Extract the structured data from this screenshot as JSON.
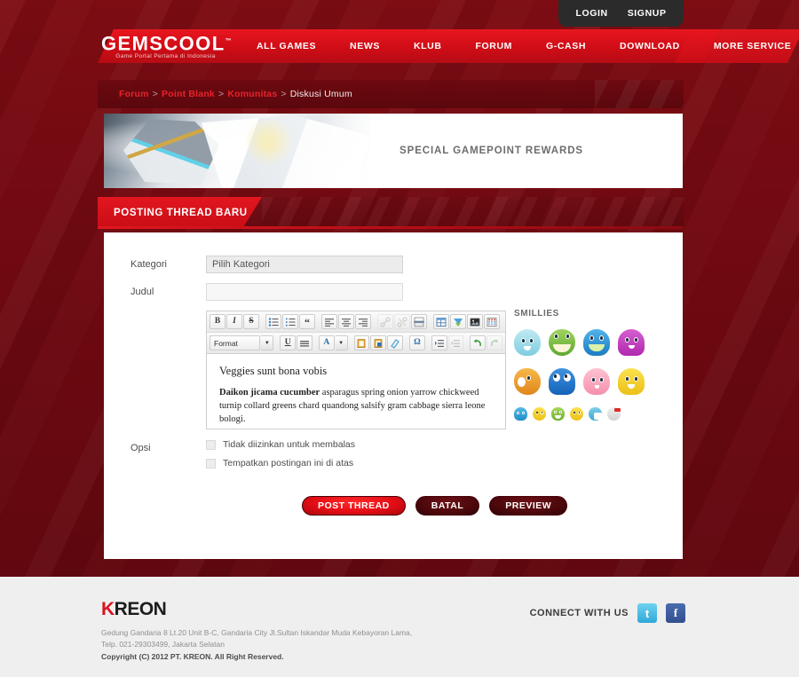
{
  "topbar": {
    "login": "LOGIN",
    "signup": "SIGNUP"
  },
  "brand": {
    "name": "GEMSCOOL",
    "tagline": "Game Portal Pertama di Indonesia",
    "tm": "™"
  },
  "nav": {
    "items": [
      "ALL GAMES",
      "NEWS",
      "KLUB",
      "FORUM",
      "G-CASH",
      "DOWNLOAD",
      "MORE SERVICE"
    ]
  },
  "breadcrumb": {
    "links": [
      "Forum",
      "Point Blank",
      "Komunitas"
    ],
    "current": "Diskusi Umum",
    "separator": ">"
  },
  "banner": {
    "title": "SPECIAL GAMEPOINT REWARDS"
  },
  "section": {
    "title": "POSTING THREAD BARU"
  },
  "form": {
    "kategori_label": "Kategori",
    "kategori_value": "Pilih Kategori",
    "judul_label": "Judul",
    "judul_value": "",
    "judul_placeholder": "",
    "opsi_label": "Opsi",
    "opsi_1": "Tidak diizinkan untuk membalas",
    "opsi_2": "Tempatkan postingan ini di atas"
  },
  "editor": {
    "format_label": "Format",
    "heading": "Veggies sunt bona vobis",
    "body_bold": "Daikon jicama cucumber",
    "body_text": " asparagus spring onion yarrow chickweed turnip collard greens chard quandong salsify gram cabbage sierra leone bologi.",
    "toolbar_row1": [
      {
        "name": "bold",
        "glyph": "B"
      },
      {
        "name": "italic",
        "glyph": "I"
      },
      {
        "name": "strikethrough",
        "glyph": "S"
      },
      {
        "name": "bulleted-list",
        "glyph": ""
      },
      {
        "name": "numbered-list",
        "glyph": ""
      },
      {
        "name": "blockquote",
        "glyph": "“"
      },
      {
        "name": "align-left",
        "glyph": ""
      },
      {
        "name": "align-center",
        "glyph": ""
      },
      {
        "name": "align-right",
        "glyph": ""
      },
      {
        "name": "link",
        "glyph": "",
        "disabled": true
      },
      {
        "name": "unlink",
        "glyph": "",
        "disabled": true
      },
      {
        "name": "page-break",
        "glyph": ""
      },
      {
        "name": "table",
        "glyph": ""
      },
      {
        "name": "flash",
        "glyph": ""
      },
      {
        "name": "image",
        "glyph": ""
      },
      {
        "name": "grid",
        "glyph": ""
      }
    ],
    "toolbar_row2": [
      {
        "name": "underline",
        "glyph": "U"
      },
      {
        "name": "justify",
        "glyph": ""
      },
      {
        "name": "text-color",
        "glyph": "A"
      },
      {
        "name": "paste",
        "glyph": ""
      },
      {
        "name": "paste-from-word",
        "glyph": ""
      },
      {
        "name": "remove-format",
        "glyph": ""
      },
      {
        "name": "special-character",
        "glyph": "Ω"
      },
      {
        "name": "indent",
        "glyph": ""
      },
      {
        "name": "outdent",
        "glyph": "",
        "disabled": true
      },
      {
        "name": "undo",
        "glyph": ""
      },
      {
        "name": "redo",
        "glyph": "",
        "disabled": true
      }
    ]
  },
  "buttons": {
    "post": "POST THREAD",
    "cancel": "BATAL",
    "preview": "PREVIEW"
  },
  "smillies": {
    "title": "SMILLIES",
    "row1": [
      {
        "name": "smiley-ghost",
        "color": "#8fd8e8"
      },
      {
        "name": "smiley-frog",
        "color": "#7dc24a"
      },
      {
        "name": "smiley-blue-creature",
        "color": "#2f9bd8"
      },
      {
        "name": "smiley-purple-octopus",
        "color": "#c93fc4"
      }
    ],
    "row2": [
      {
        "name": "smiley-orange-laugh",
        "color": "#f0a024"
      },
      {
        "name": "smiley-blue-big-eyes",
        "color": "#2f7fd8"
      },
      {
        "name": "smiley-pink-shy",
        "color": "#f3a3b8"
      },
      {
        "name": "smiley-yellow-happy",
        "color": "#f5d431"
      }
    ],
    "row3": [
      {
        "name": "smiley-blue-whale",
        "color": "#3aa7d8"
      },
      {
        "name": "smiley-yellow-smile",
        "color": "#f5d431"
      },
      {
        "name": "smiley-green-glasses",
        "color": "#8cc63f"
      },
      {
        "name": "smiley-yellow-wink",
        "color": "#f5d431"
      },
      {
        "name": "smiley-tissue",
        "color": "#6fc3d8"
      },
      {
        "name": "smiley-white-flag",
        "color": "#dcdcdc"
      }
    ]
  },
  "footer": {
    "logo_k": "K",
    "logo_rest": "REON",
    "address_line1": "Gedung Gandaria 8 Lt.20 Unit B-C, Gandaria City Jl.Sultan Iskandar Muda Kebayoran Lama,",
    "address_line2": "Telp. 021-29303499, Jakarta Selatan",
    "copyright": "Copyright (C) 2012 PT. KREON. All Right Reserved.",
    "connect_label": "CONNECT WITH US",
    "twitter": "t",
    "facebook": "f"
  }
}
